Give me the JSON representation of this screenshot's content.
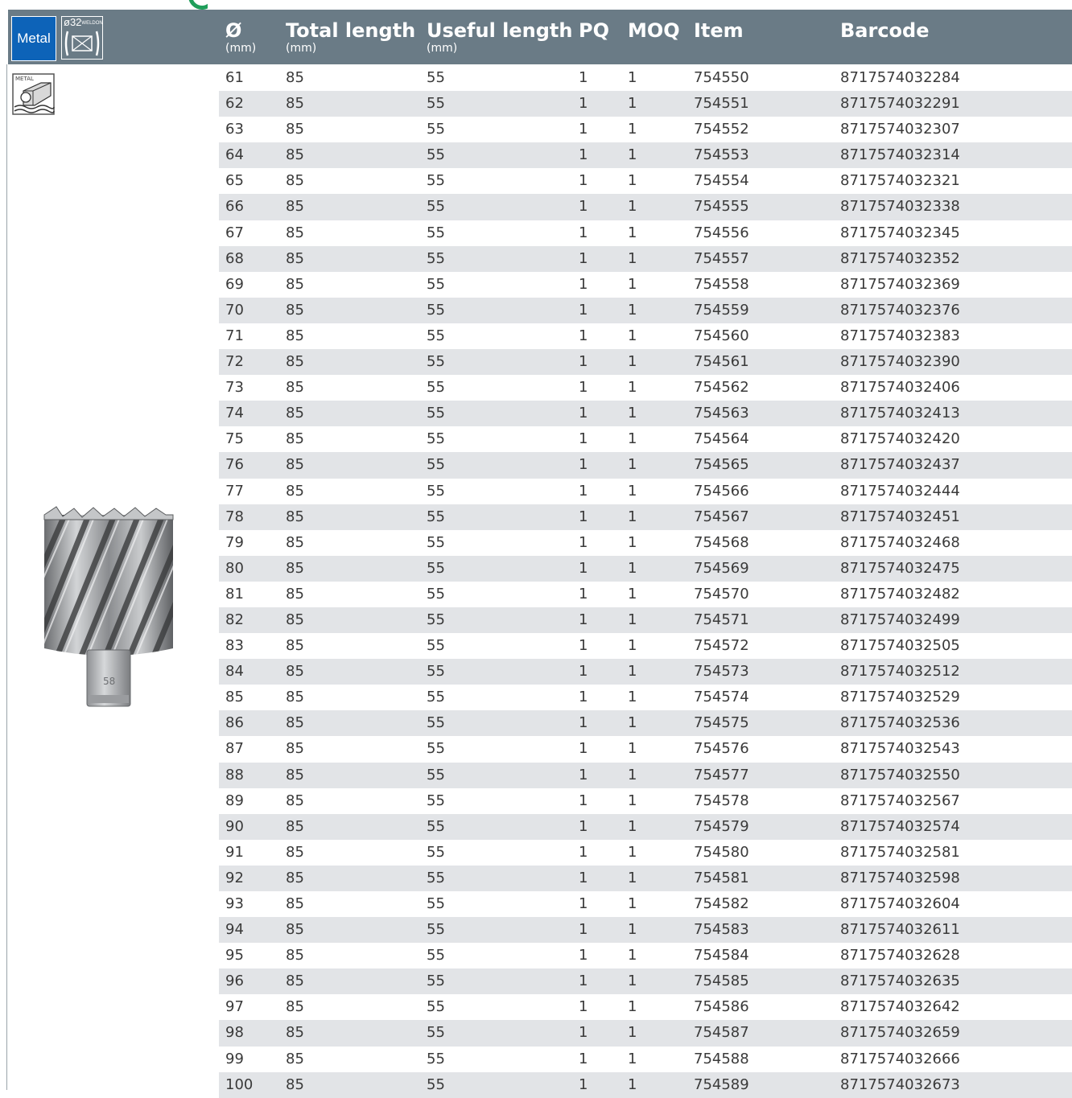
{
  "header": {
    "metal_badge": "Metal",
    "weldon_badge": {
      "size": "ø32",
      "label": "WELDON"
    },
    "columns": [
      {
        "title": "Ø",
        "unit": "(mm)"
      },
      {
        "title": "Total length",
        "unit": "(mm)"
      },
      {
        "title": "Useful length",
        "unit": "(mm)"
      },
      {
        "title": "PQ",
        "unit": ""
      },
      {
        "title": "MOQ",
        "unit": ""
      },
      {
        "title": "Item",
        "unit": ""
      },
      {
        "title": "Barcode",
        "unit": ""
      }
    ]
  },
  "side": {
    "material_icon_label": "METAL",
    "product_marking": "58"
  },
  "colors": {
    "header_bg": "#6a7b86",
    "badge_blue": "#0d63b8",
    "row_stripe": "#e2e4e7"
  },
  "rows": [
    [
      "61",
      "85",
      "55",
      "1",
      "1",
      "754550",
      "8717574032284"
    ],
    [
      "62",
      "85",
      "55",
      "1",
      "1",
      "754551",
      "8717574032291"
    ],
    [
      "63",
      "85",
      "55",
      "1",
      "1",
      "754552",
      "8717574032307"
    ],
    [
      "64",
      "85",
      "55",
      "1",
      "1",
      "754553",
      "8717574032314"
    ],
    [
      "65",
      "85",
      "55",
      "1",
      "1",
      "754554",
      "8717574032321"
    ],
    [
      "66",
      "85",
      "55",
      "1",
      "1",
      "754555",
      "8717574032338"
    ],
    [
      "67",
      "85",
      "55",
      "1",
      "1",
      "754556",
      "8717574032345"
    ],
    [
      "68",
      "85",
      "55",
      "1",
      "1",
      "754557",
      "8717574032352"
    ],
    [
      "69",
      "85",
      "55",
      "1",
      "1",
      "754558",
      "8717574032369"
    ],
    [
      "70",
      "85",
      "55",
      "1",
      "1",
      "754559",
      "8717574032376"
    ],
    [
      "71",
      "85",
      "55",
      "1",
      "1",
      "754560",
      "8717574032383"
    ],
    [
      "72",
      "85",
      "55",
      "1",
      "1",
      "754561",
      "8717574032390"
    ],
    [
      "73",
      "85",
      "55",
      "1",
      "1",
      "754562",
      "8717574032406"
    ],
    [
      "74",
      "85",
      "55",
      "1",
      "1",
      "754563",
      "8717574032413"
    ],
    [
      "75",
      "85",
      "55",
      "1",
      "1",
      "754564",
      "8717574032420"
    ],
    [
      "76",
      "85",
      "55",
      "1",
      "1",
      "754565",
      "8717574032437"
    ],
    [
      "77",
      "85",
      "55",
      "1",
      "1",
      "754566",
      "8717574032444"
    ],
    [
      "78",
      "85",
      "55",
      "1",
      "1",
      "754567",
      "8717574032451"
    ],
    [
      "79",
      "85",
      "55",
      "1",
      "1",
      "754568",
      "8717574032468"
    ],
    [
      "80",
      "85",
      "55",
      "1",
      "1",
      "754569",
      "8717574032475"
    ],
    [
      "81",
      "85",
      "55",
      "1",
      "1",
      "754570",
      "8717574032482"
    ],
    [
      "82",
      "85",
      "55",
      "1",
      "1",
      "754571",
      "8717574032499"
    ],
    [
      "83",
      "85",
      "55",
      "1",
      "1",
      "754572",
      "8717574032505"
    ],
    [
      "84",
      "85",
      "55",
      "1",
      "1",
      "754573",
      "8717574032512"
    ],
    [
      "85",
      "85",
      "55",
      "1",
      "1",
      "754574",
      "8717574032529"
    ],
    [
      "86",
      "85",
      "55",
      "1",
      "1",
      "754575",
      "8717574032536"
    ],
    [
      "87",
      "85",
      "55",
      "1",
      "1",
      "754576",
      "8717574032543"
    ],
    [
      "88",
      "85",
      "55",
      "1",
      "1",
      "754577",
      "8717574032550"
    ],
    [
      "89",
      "85",
      "55",
      "1",
      "1",
      "754578",
      "8717574032567"
    ],
    [
      "90",
      "85",
      "55",
      "1",
      "1",
      "754579",
      "8717574032574"
    ],
    [
      "91",
      "85",
      "55",
      "1",
      "1",
      "754580",
      "8717574032581"
    ],
    [
      "92",
      "85",
      "55",
      "1",
      "1",
      "754581",
      "8717574032598"
    ],
    [
      "93",
      "85",
      "55",
      "1",
      "1",
      "754582",
      "8717574032604"
    ],
    [
      "94",
      "85",
      "55",
      "1",
      "1",
      "754583",
      "8717574032611"
    ],
    [
      "95",
      "85",
      "55",
      "1",
      "1",
      "754584",
      "8717574032628"
    ],
    [
      "96",
      "85",
      "55",
      "1",
      "1",
      "754585",
      "8717574032635"
    ],
    [
      "97",
      "85",
      "55",
      "1",
      "1",
      "754586",
      "8717574032642"
    ],
    [
      "98",
      "85",
      "55",
      "1",
      "1",
      "754587",
      "8717574032659"
    ],
    [
      "99",
      "85",
      "55",
      "1",
      "1",
      "754588",
      "8717574032666"
    ],
    [
      "100",
      "85",
      "55",
      "1",
      "1",
      "754589",
      "8717574032673"
    ]
  ]
}
